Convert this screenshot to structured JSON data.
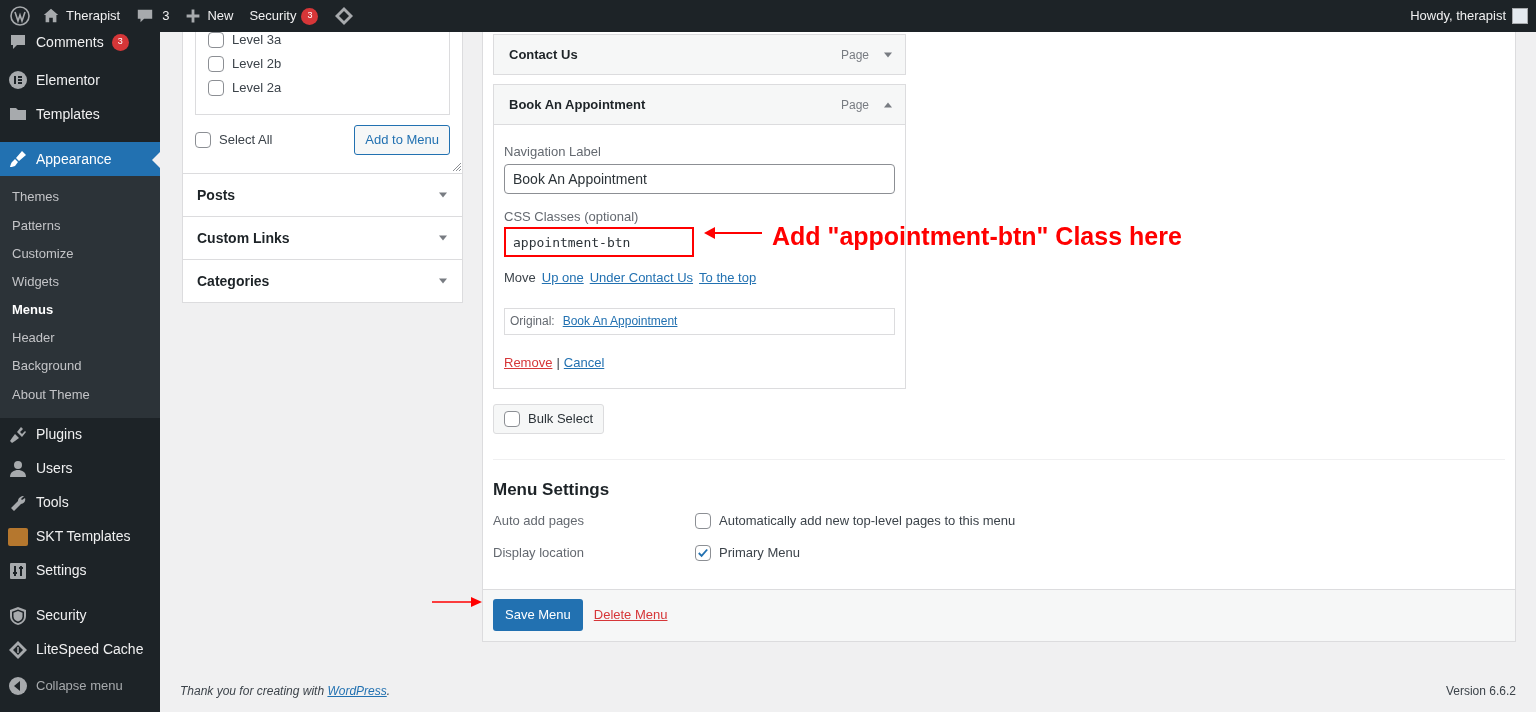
{
  "admin_bar": {
    "items": [
      {
        "kind": "logo"
      },
      {
        "kind": "site",
        "label": "Therapist"
      },
      {
        "kind": "comments",
        "label": "3"
      },
      {
        "kind": "new",
        "label": "New"
      },
      {
        "kind": "security",
        "label": "Security",
        "badge": "3"
      },
      {
        "kind": "litespeed"
      }
    ],
    "account": "Howdy, therapist"
  },
  "sidebar": {
    "items": [
      {
        "kind": "comments",
        "label": "Comments",
        "badge": "3",
        "current": false
      },
      {
        "kind": "elementor",
        "label": "Elementor",
        "current": false
      },
      {
        "kind": "folder",
        "label": "Templates",
        "current": false
      },
      {
        "kind": "brush",
        "label": "Appearance",
        "current": true,
        "submenu": [
          {
            "label": "Themes",
            "selected": false
          },
          {
            "label": "Patterns",
            "selected": false
          },
          {
            "label": "Customize",
            "selected": false
          },
          {
            "label": "Widgets",
            "selected": false
          },
          {
            "label": "Menus",
            "selected": true
          },
          {
            "label": "Header",
            "selected": false
          },
          {
            "label": "Background",
            "selected": false
          },
          {
            "label": "About Theme",
            "selected": false
          }
        ]
      },
      {
        "kind": "plug",
        "label": "Plugins",
        "current": false
      },
      {
        "kind": "user",
        "label": "Users",
        "current": false
      },
      {
        "kind": "wrench",
        "label": "Tools",
        "current": false
      },
      {
        "kind": "skt",
        "label": "SKT Templates",
        "current": false
      },
      {
        "kind": "sliders",
        "label": "Settings",
        "current": false
      },
      {
        "kind": "shield",
        "label": "Security",
        "current": false
      },
      {
        "kind": "diamond",
        "label": "LiteSpeed Cache",
        "current": false
      }
    ],
    "collapse": "Collapse menu"
  },
  "add_items": {
    "pages": [
      {
        "label": "Level 3a",
        "checked": false
      },
      {
        "label": "Level 2b",
        "checked": false
      },
      {
        "label": "Level 2a",
        "checked": false
      }
    ],
    "select_all": {
      "label": "Select All",
      "checked": false
    },
    "add_button": "Add to Menu",
    "sections": [
      {
        "label": "Posts",
        "expanded": false
      },
      {
        "label": "Custom Links",
        "expanded": false
      },
      {
        "label": "Categories",
        "expanded": false
      }
    ]
  },
  "menu_items": [
    {
      "title": "Contact Us",
      "type": "Page",
      "expanded": false
    },
    {
      "title": "Book An Appointment",
      "type": "Page",
      "expanded": true,
      "nav_label": {
        "label": "Navigation Label",
        "value": "Book An Appointment"
      },
      "css_classes": {
        "label": "CSS Classes (optional)",
        "value": "appointment-btn"
      },
      "move": {
        "label": "Move",
        "links": [
          "Up one",
          "Under Contact Us",
          "To the top"
        ]
      },
      "original": {
        "label": "Original:",
        "link": "Book An Appointment"
      },
      "remove": "Remove",
      "separator": "|",
      "cancel": "Cancel"
    }
  ],
  "bulk_select": {
    "label": "Bulk Select",
    "checked": false
  },
  "menu_settings": {
    "title": "Menu Settings",
    "rows": [
      {
        "label": "Auto add pages",
        "option": "Automatically add new top-level pages to this menu",
        "checked": false
      },
      {
        "label": "Display location",
        "option": "Primary Menu",
        "checked": true
      }
    ]
  },
  "actions": {
    "save": "Save Menu",
    "delete": "Delete Menu"
  },
  "annotations": {
    "callout": "Add \"appointment-btn\" Class here",
    "save_arrow": true
  },
  "footer": {
    "text": "Thank you for creating with ",
    "link": "WordPress",
    "end": ".",
    "version": "Version 6.6.2"
  }
}
